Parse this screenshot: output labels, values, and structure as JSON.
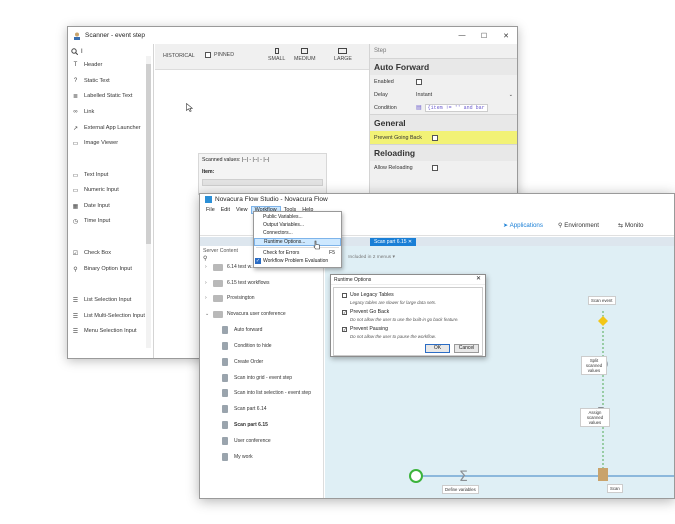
{
  "scanner_window": {
    "title": "Scanner - event step",
    "controls": {
      "minimize": "—",
      "maximize": "☐",
      "close": "✕"
    },
    "search_value": "I",
    "palette": [
      {
        "icon": "header-icon",
        "glyph": "T",
        "label": "Header"
      },
      {
        "icon": "question-icon",
        "glyph": "?",
        "label": "Static Text"
      },
      {
        "icon": "label-icon",
        "glyph": "≣",
        "label": "Labelled Static Text"
      },
      {
        "icon": "link-icon",
        "glyph": "∞",
        "label": "Link"
      },
      {
        "icon": "external-launch-icon",
        "glyph": "↗",
        "label": "External App Launcher"
      },
      {
        "icon": "image-icon",
        "glyph": "▭",
        "label": "Image Viewer"
      },
      {
        "icon": "text-input-icon",
        "glyph": "▭",
        "label": "Text Input"
      },
      {
        "icon": "numeric-input-icon",
        "glyph": "▭",
        "label": "Numeric Input"
      },
      {
        "icon": "calendar-icon",
        "glyph": "▦",
        "label": "Date Input"
      },
      {
        "icon": "clock-icon",
        "glyph": "◷",
        "label": "Time Input"
      },
      {
        "icon": "checkbox-icon",
        "glyph": "☑",
        "label": "Check Box"
      },
      {
        "icon": "binary-option-icon",
        "glyph": "⚲",
        "label": "Binary Option Input"
      },
      {
        "icon": "list-selection-icon",
        "glyph": "☰",
        "label": "List Selection Input"
      },
      {
        "icon": "list-multi-icon",
        "glyph": "☰",
        "label": "List Multi-Selection Input"
      },
      {
        "icon": "menu-selection-icon",
        "glyph": "☰",
        "label": "Menu Selection Input"
      }
    ],
    "toolbar": {
      "historical": "HISTORICAL",
      "pinned": "PINNED",
      "small": "SMALL",
      "medium": "MEDIUM",
      "large": "LARGE"
    },
    "scan_box": {
      "scanned_values": "Scanned values: |--| - |--| - |--|",
      "item_label": "Item:"
    },
    "properties": {
      "header": "Step",
      "auto_forward": {
        "title": "Auto Forward",
        "enabled_label": "Enabled",
        "delay_label": "Delay",
        "delay_value": "Instant",
        "condition_label": "Condition",
        "condition_value": "{item != '' and bar"
      },
      "general": {
        "title": "General",
        "prevent_going_back": "Prevent Going Back"
      },
      "reloading": {
        "title": "Reloading",
        "allow_reloading": "Allow Reloading"
      }
    }
  },
  "flow_window": {
    "title": "Novacura Flow Studio - Novacura Flow",
    "menu": [
      "File",
      "Edit",
      "View",
      "Workflow",
      "Tools",
      "Help"
    ],
    "topnav": {
      "applications": "Applications",
      "environment": "Environment",
      "monitor": "Monito"
    },
    "tab_label": "Scan part 6.15",
    "subtoolbar": "Included in 2 menus",
    "server_content": "Server Content",
    "tree": [
      {
        "type": "folder",
        "label": "6.14 test w...",
        "caret": "›"
      },
      {
        "type": "folder",
        "label": "6.15 test workflows",
        "caret": "›"
      },
      {
        "type": "folder",
        "label": "Provisington",
        "caret": "›"
      },
      {
        "type": "folder-open",
        "label": "Novacura user conference",
        "caret": "⌄"
      },
      {
        "type": "doc",
        "label": "Auto forward"
      },
      {
        "type": "doc",
        "label": "Condition to hide"
      },
      {
        "type": "doc",
        "label": "Create Order"
      },
      {
        "type": "doc",
        "label": "Scan into grid - event step"
      },
      {
        "type": "doc",
        "label": "Scan into list selection - event step"
      },
      {
        "type": "doc",
        "label": "Scan part 6.14"
      },
      {
        "type": "doc-bold",
        "label": "Scan part 6.15"
      },
      {
        "type": "doc2",
        "label": "User conference"
      },
      {
        "type": "doc2",
        "label": "My work"
      }
    ],
    "workflow_menu": {
      "items": [
        {
          "label": "Public Variables...",
          "shortcut": ""
        },
        {
          "label": "Output Variables...",
          "shortcut": ""
        },
        {
          "label": "Connectors...",
          "shortcut": ""
        },
        {
          "label": "Runtime Options...",
          "shortcut": ""
        },
        {
          "label": "Check for Errors",
          "shortcut": "F5"
        },
        {
          "label": "Workflow Problem Evaluation",
          "shortcut": ""
        }
      ]
    },
    "runtime_dialog": {
      "title": "Runtime Options",
      "close": "✕",
      "options": [
        {
          "label": "Use Legacy Tables",
          "desc": "Legacy tables are slower for large data sets.",
          "checked": false
        },
        {
          "label": "Prevent Go Back",
          "desc": "Do not allow the user to use the built-in go back feature.",
          "checked": true
        },
        {
          "label": "Prevent Pausing",
          "desc": "Do not allow the user to pause the workflow.",
          "checked": true
        }
      ],
      "ok": "OK",
      "cancel": "Cancel"
    },
    "flow_nodes": {
      "scan_event": "Scan event",
      "split": "Split scanned values",
      "assign": "Assign scanned values",
      "define": "Define variables",
      "scan": "Scan"
    }
  }
}
